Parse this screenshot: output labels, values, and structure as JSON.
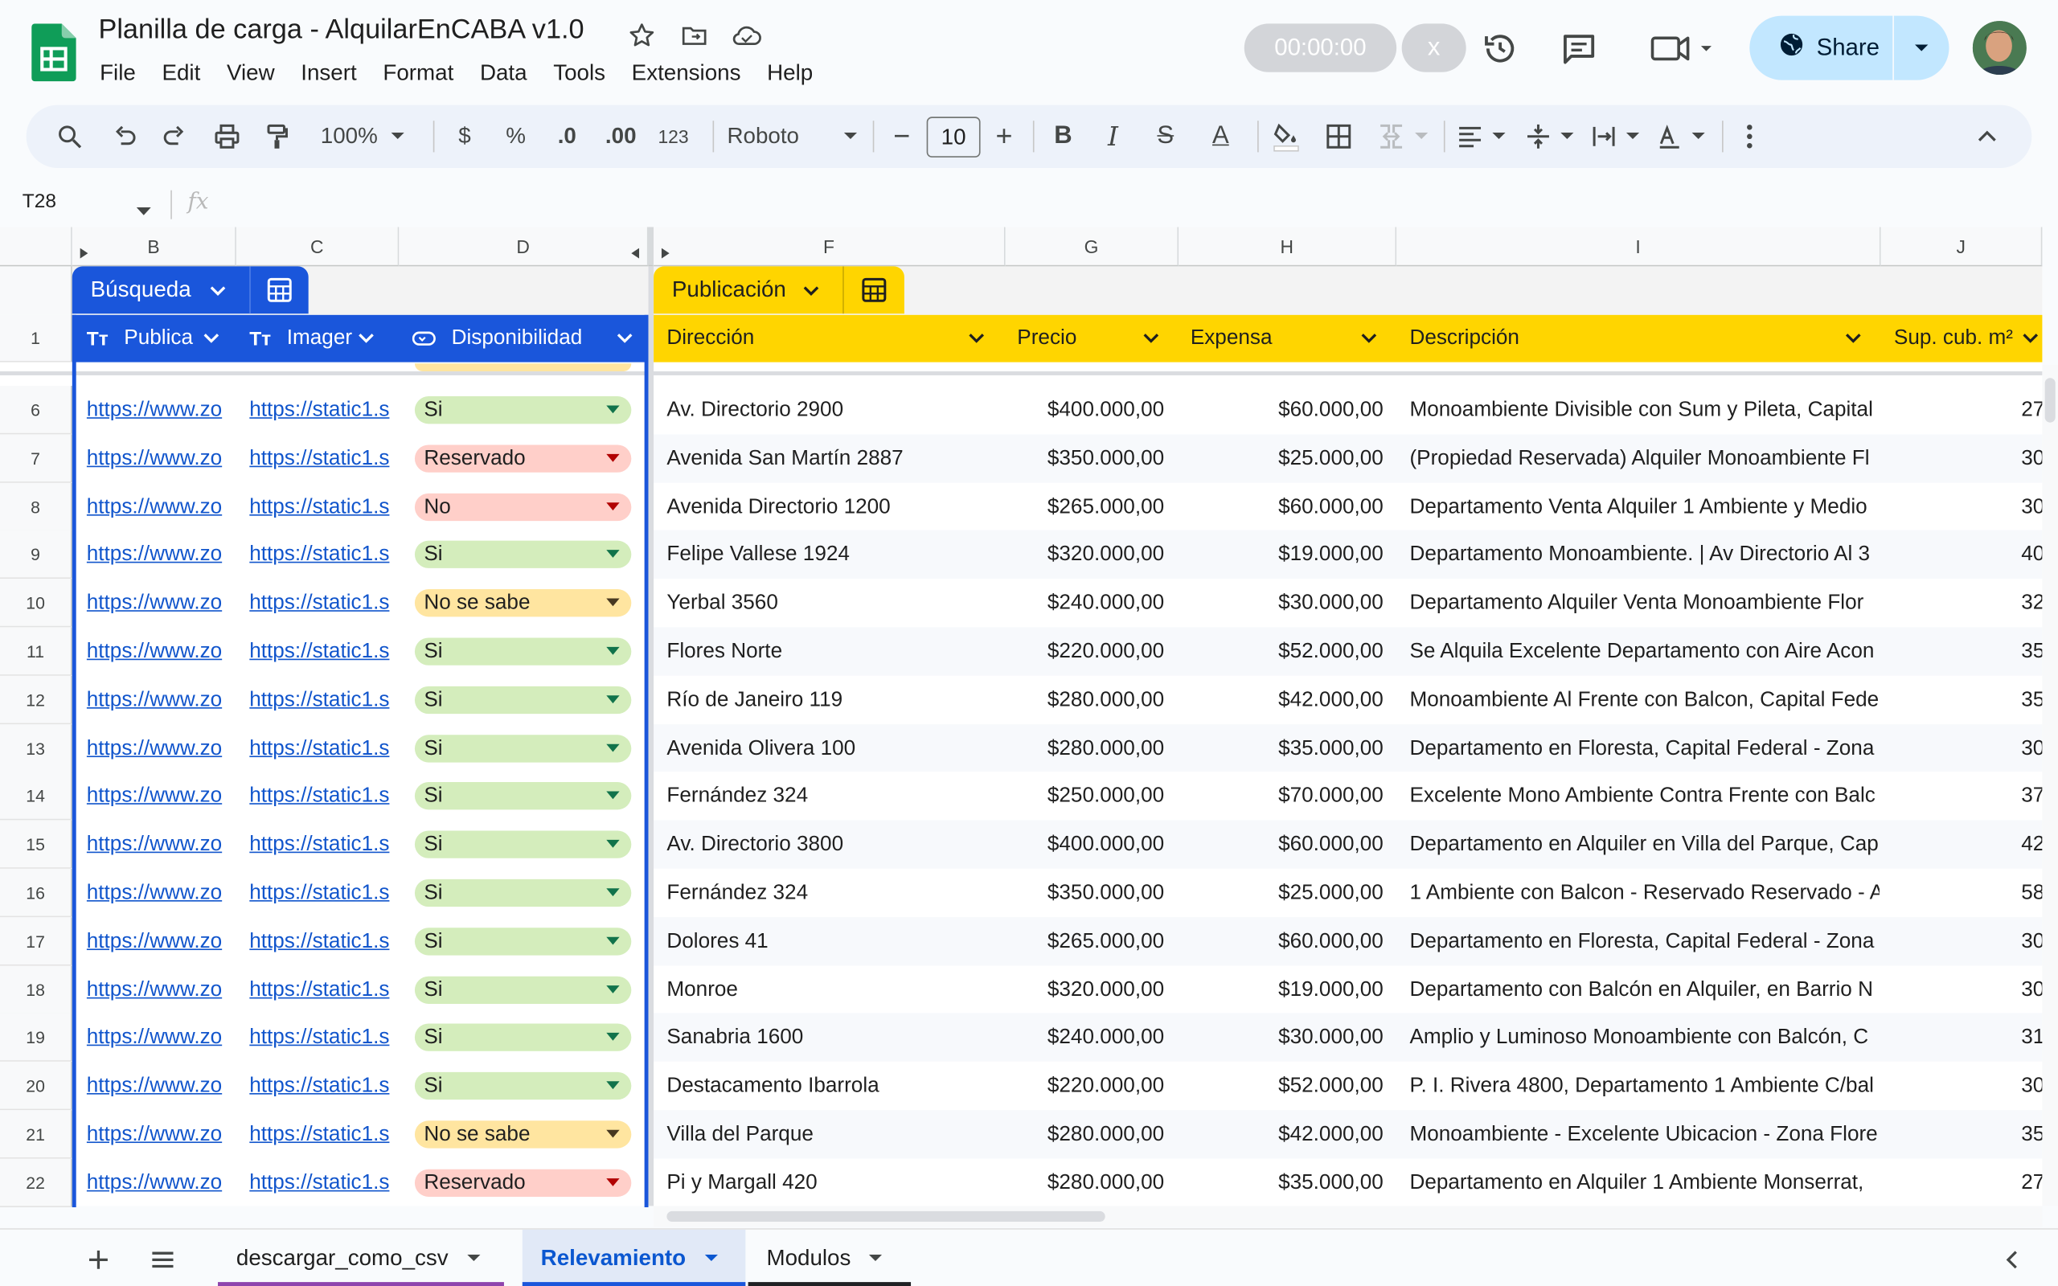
{
  "doc": {
    "title": "Planilla de carga - AlquilarEnCABA v1.0",
    "menu": [
      "File",
      "Edit",
      "View",
      "Insert",
      "Format",
      "Data",
      "Tools",
      "Extensions",
      "Help"
    ]
  },
  "header": {
    "timer": "00:00:00",
    "timer_close": "x",
    "share_label": "Share"
  },
  "toolbar": {
    "zoom": "100%",
    "currency": "$",
    "percent": "%",
    "dec_decrease": ".0",
    "dec_increase": ".00",
    "format_123": "123",
    "font": "Roboto",
    "font_size": "10",
    "minus": "−",
    "plus": "+",
    "bold": "B",
    "italic": "I",
    "strike": "S",
    "text_color": "A"
  },
  "formula_bar": {
    "name_box": "T28",
    "fx": "fx"
  },
  "columns": [
    "B",
    "C",
    "D",
    "F",
    "G",
    "H",
    "I",
    "J"
  ],
  "tables": {
    "left": {
      "name": "Búsqueda"
    },
    "right": {
      "name": "Publicación"
    }
  },
  "headers": {
    "b": "Publica",
    "c": "Imager",
    "d": "Disponibilidad",
    "f": "Dirección",
    "g": "Precio",
    "h": "Expensa",
    "i": "Descripción",
    "j": "Sup. cub. m²"
  },
  "header_row_num": "1",
  "rows": [
    {
      "n": "6",
      "b": "https://www.zo",
      "c": "https://static1.s",
      "d": "Si",
      "f": "Av. Directorio 2900",
      "g": "$400.000,00",
      "h": "$60.000,00",
      "i": "Monoambiente Divisible con Sum y Pileta, Capital",
      "j": "27"
    },
    {
      "n": "7",
      "b": "https://www.zo",
      "c": "https://static1.s",
      "d": "Reservado",
      "f": "Avenida San Martín 2887",
      "g": "$350.000,00",
      "h": "$25.000,00",
      "i": "(Propiedad Reservada) Alquiler Monoambiente Fl",
      "j": "30"
    },
    {
      "n": "8",
      "b": "https://www.zo",
      "c": "https://static1.s",
      "d": "No",
      "f": "Avenida Directorio 1200",
      "g": "$265.000,00",
      "h": "$60.000,00",
      "i": "Departamento Venta Alquiler 1 Ambiente y Medio",
      "j": "30"
    },
    {
      "n": "9",
      "b": "https://www.zo",
      "c": "https://static1.s",
      "d": "Si",
      "f": "Felipe Vallese 1924",
      "g": "$320.000,00",
      "h": "$19.000,00",
      "i": "Departamento Monoambiente. | Av Directorio Al 3",
      "j": "40"
    },
    {
      "n": "10",
      "b": "https://www.zo",
      "c": "https://static1.s",
      "d": "No se sabe",
      "f": "Yerbal 3560",
      "g": "$240.000,00",
      "h": "$30.000,00",
      "i": "Departamento Alquiler Venta Monoambiente Flor",
      "j": "32"
    },
    {
      "n": "11",
      "b": "https://www.zo",
      "c": "https://static1.s",
      "d": "Si",
      "f": "Flores Norte",
      "g": "$220.000,00",
      "h": "$52.000,00",
      "i": "Se Alquila Excelente Departamento con Aire Acon",
      "j": "35"
    },
    {
      "n": "12",
      "b": "https://www.zo",
      "c": "https://static1.s",
      "d": "Si",
      "f": "Río de Janeiro 119",
      "g": "$280.000,00",
      "h": "$42.000,00",
      "i": "Monoambiente Al Frente con Balcon, Capital Fede",
      "j": "35"
    },
    {
      "n": "13",
      "b": "https://www.zo",
      "c": "https://static1.s",
      "d": "Si",
      "f": "Avenida Olivera 100",
      "g": "$280.000,00",
      "h": "$35.000,00",
      "i": "Departamento en Floresta, Capital Federal - Zona",
      "j": "30"
    },
    {
      "n": "14",
      "b": "https://www.zo",
      "c": "https://static1.s",
      "d": "Si",
      "f": "Fernández 324",
      "g": "$250.000,00",
      "h": "$70.000,00",
      "i": "Excelente Mono Ambiente Contra Frente con Balc",
      "j": "37"
    },
    {
      "n": "15",
      "b": "https://www.zo",
      "c": "https://static1.s",
      "d": "Si",
      "f": "Av. Directorio 3800",
      "g": "$400.000,00",
      "h": "$60.000,00",
      "i": "Departamento en Alquiler en Villa del Parque, Cap",
      "j": "42"
    },
    {
      "n": "16",
      "b": "https://www.zo",
      "c": "https://static1.s",
      "d": "Si",
      "f": "Fernández 324",
      "g": "$350.000,00",
      "h": "$25.000,00",
      "i": "1 Ambiente con Balcon - Reservado Reservado - A",
      "j": "58"
    },
    {
      "n": "17",
      "b": "https://www.zo",
      "c": "https://static1.s",
      "d": "Si",
      "f": "Dolores 41",
      "g": "$265.000,00",
      "h": "$60.000,00",
      "i": "Departamento en Floresta, Capital Federal - Zona",
      "j": "30"
    },
    {
      "n": "18",
      "b": "https://www.zo",
      "c": "https://static1.s",
      "d": "Si",
      "f": "Monroe",
      "g": "$320.000,00",
      "h": "$19.000,00",
      "i": "Departamento con Balcón en Alquiler, en Barrio N",
      "j": "30"
    },
    {
      "n": "19",
      "b": "https://www.zo",
      "c": "https://static1.s",
      "d": "Si",
      "f": "Sanabria 1600",
      "g": "$240.000,00",
      "h": "$30.000,00",
      "i": "Amplio y Luminoso Monoambiente con Balcón, C",
      "j": "31"
    },
    {
      "n": "20",
      "b": "https://www.zo",
      "c": "https://static1.s",
      "d": "Si",
      "f": "Destacamento Ibarrola",
      "g": "$220.000,00",
      "h": "$52.000,00",
      "i": "P. I. Rivera 4800, Departamento 1 Ambiente C/bal",
      "j": "30"
    },
    {
      "n": "21",
      "b": "https://www.zo",
      "c": "https://static1.s",
      "d": "No se sabe",
      "f": "Villa del Parque",
      "g": "$280.000,00",
      "h": "$42.000,00",
      "i": "Monoambiente - Excelente Ubicacion - Zona Flore",
      "j": "35"
    },
    {
      "n": "22",
      "b": "https://www.zo",
      "c": "https://static1.s",
      "d": "Reservado",
      "f": "Pi y Margall 420",
      "g": "$280.000,00",
      "h": "$35.000,00",
      "i": "Departamento en Alquiler 1 Ambiente Monserrat,",
      "j": "27"
    }
  ],
  "chip_colors": {
    "Si": {
      "bg": "#d4edbc",
      "arrow": "#11734b"
    },
    "Reservado": {
      "bg": "#ffcfc9",
      "arrow": "#b10202"
    },
    "No": {
      "bg": "#ffcfc9",
      "arrow": "#b10202"
    },
    "No se sabe": {
      "bg": "#ffe5a0",
      "arrow": "#473821"
    }
  },
  "colors": {
    "left_table": "#1a56db",
    "right_table": "#ffd500"
  },
  "sheets": [
    {
      "name": "descargar_como_csv",
      "underline": "#8e44ad"
    },
    {
      "name": "Relevamiento",
      "underline": "#1a56db",
      "active": true
    },
    {
      "name": "Modulos",
      "underline": "#202124"
    }
  ],
  "icons": [
    "sheets-logo-icon",
    "star-icon",
    "move-folder-icon",
    "cloud-status-icon",
    "history-icon",
    "comment-icon",
    "meet-icon",
    "globe-icon",
    "search-icon",
    "undo-icon",
    "redo-icon",
    "print-icon",
    "paint-format-icon"
  ]
}
